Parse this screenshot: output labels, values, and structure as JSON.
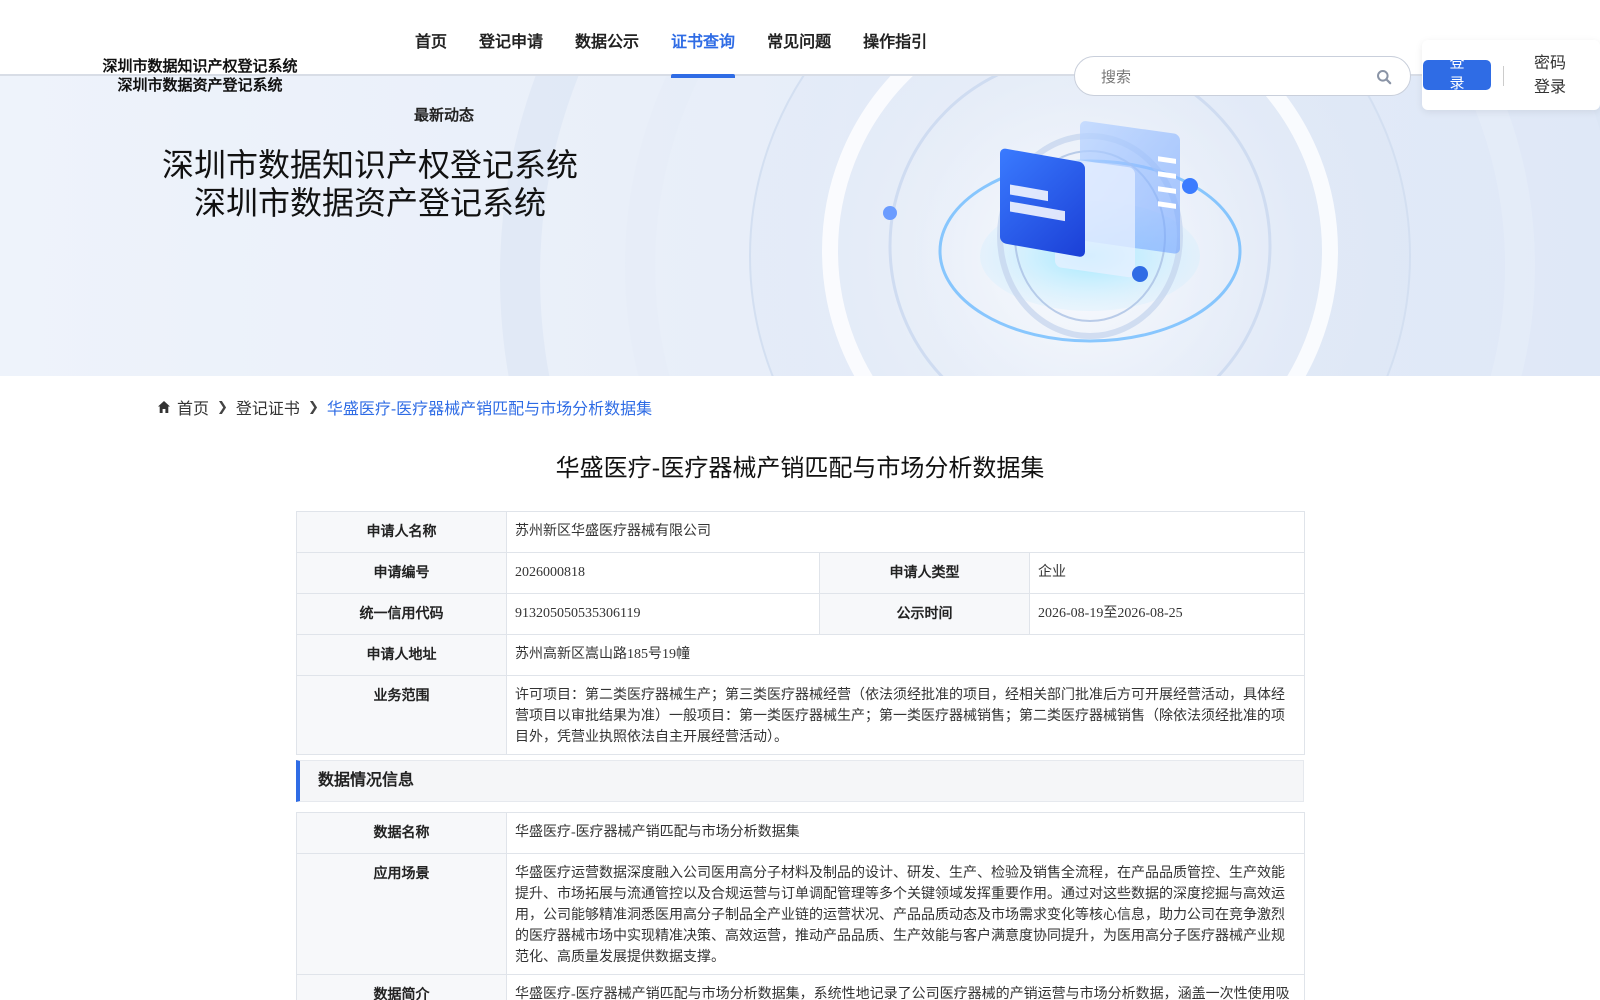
{
  "header": {
    "site_title_line1": "深圳市数据知识产权登记系统",
    "site_title_line2": "深圳市数据资产登记系统",
    "nav": [
      {
        "label": "首页"
      },
      {
        "label": "登记申请"
      },
      {
        "label": "数据公示"
      },
      {
        "label": "证书查询"
      },
      {
        "label": "常见问题"
      },
      {
        "label": "操作指引"
      }
    ],
    "active_nav": "证书查询",
    "sub_nav": "最新动态",
    "search": {
      "placeholder": "搜索"
    },
    "login_label": "登录",
    "password_login_label": "密码登录",
    "accent_color": "#2f6ce5"
  },
  "banner": {
    "title_line1": "深圳市数据知识产权登记系统",
    "title_line2": "深圳市数据资产登记系统"
  },
  "breadcrumb": {
    "home": "首页",
    "level2": "登记证书",
    "current": "华盛医疗-医疗器械产销匹配与市场分析数据集"
  },
  "main": {
    "title": "华盛医疗-医疗器械产销匹配与市场分析数据集",
    "applicant": {
      "name_label": "申请人名称",
      "name_value": "苏州新区华盛医疗器械有限公司",
      "number_label": "申请编号",
      "number_value": "2026000818",
      "type_label": "申请人类型",
      "type_value": "企业",
      "credit_label": "统一信用代码",
      "credit_value": "913205050535306119",
      "publicity_label": "公示时间",
      "publicity_value": "2026-08-19至2026-08-25",
      "address_label": "申请人地址",
      "address_value": "苏州高新区嵩山路185号19幢",
      "scope_label": "业务范围",
      "scope_value": "许可项目：第二类医疗器械生产；第三类医疗器械经营（依法须经批准的项目，经相关部门批准后方可开展经营活动，具体经营项目以审批结果为准）一般项目：第一类医疗器械生产；第一类医疗器械销售；第二类医疗器械销售（除依法须经批准的项目外，凭营业执照依法自主开展经营活动）。"
    },
    "data_section_title": "数据情况信息",
    "data_info": {
      "name_label": "数据名称",
      "name_value": "华盛医疗-医疗器械产销匹配与市场分析数据集",
      "scenario_label": "应用场景",
      "scenario_value": "华盛医疗运营数据深度融入公司医用高分子材料及制品的设计、研发、生产、检验及销售全流程，在产品品质管控、生产效能提升、市场拓展与流通管控以及合规运营与订单调配管理等多个关键领域发挥重要作用。通过对这些数据的深度挖掘与高效运用，公司能够精准洞悉医用高分子制品全产业链的运营状况、产品品质动态及市场需求变化等核心信息，助力公司在竞争激烈的医疗器械市场中实现精准决策、高效运营，推动产品品质、生产效能与客户满意度协同提升，为医用高分子医疗器械产业规范化、高质量发展提供数据支撑。",
      "intro_label": "数据简介",
      "intro_value": "华盛医疗-医疗器械产销匹配与市场分析数据集，系统性地记录了公司医疗器械的产销运营与市场分析数据，涵盖一次性使用吸氧装置（面罩/成人）、一次性使用负压引流装置（3500ml）、一次性使用脑室外引流器、一次性使用泌尿道用导丝（亲水导丝）"
    }
  }
}
